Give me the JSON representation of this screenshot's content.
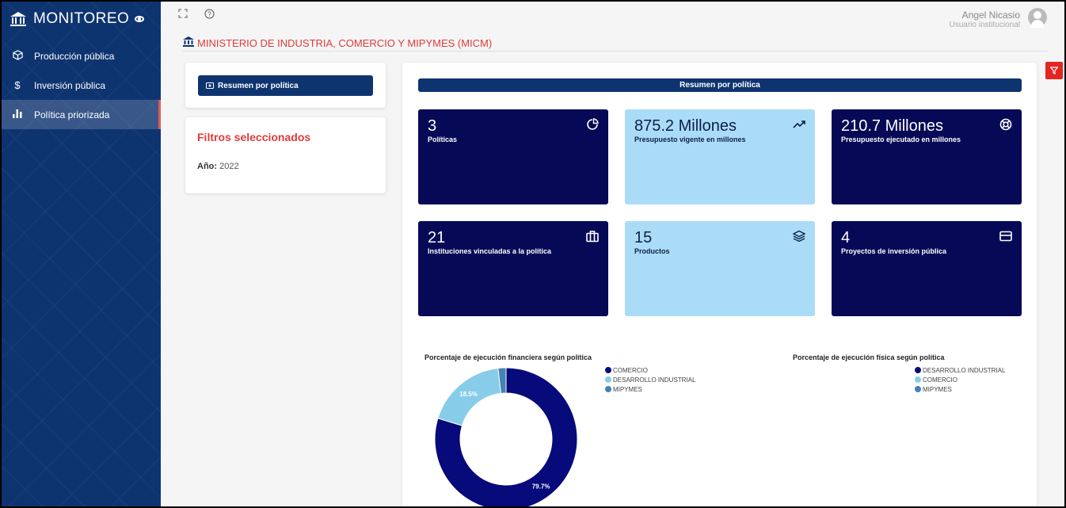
{
  "app": {
    "title": "MONITOREO"
  },
  "sidebar": {
    "items": [
      {
        "label": "Producción pública",
        "icon": "cube-icon"
      },
      {
        "label": "Inversión pública",
        "icon": "dollar-icon"
      },
      {
        "label": "Política priorizada",
        "icon": "bar-chart-icon"
      }
    ]
  },
  "user": {
    "name": "Angel Nicasio",
    "role": "Usuario institucional"
  },
  "ministry": {
    "name": "MINISTERIO DE INDUSTRIA, COMERCIO Y MIPYMES (MICM)"
  },
  "left": {
    "summary_button": "Resumen por política",
    "filters_title": "Filtros seleccionados",
    "year_label": "Año:",
    "year_value": "2022"
  },
  "main": {
    "header": "Resumen por política",
    "kpis": [
      {
        "value": "3",
        "label": "Políticas",
        "icon": "pie-icon",
        "theme": "dark"
      },
      {
        "value": "875.2 Millones",
        "label": "Presupuesto vigente en millones",
        "icon": "trending-up-icon",
        "theme": "light"
      },
      {
        "value": "210.7 Millones",
        "label": "Presupuesto ejecutado en millones",
        "icon": "lifebuoy-icon",
        "theme": "dark"
      },
      {
        "value": "21",
        "label": "Instituciones vinculadas a la política",
        "icon": "briefcase-icon",
        "theme": "dark"
      },
      {
        "value": "15",
        "label": "Productos",
        "icon": "layers-icon",
        "theme": "light"
      },
      {
        "value": "4",
        "label": "Proyectos de inversión pública",
        "icon": "credit-card-icon",
        "theme": "dark"
      }
    ]
  },
  "colors": {
    "navy": "#060a56",
    "light_blue": "#87cdea",
    "steel_blue": "#4682b4",
    "red": "#e03a3a"
  },
  "chart_data": [
    {
      "type": "pie",
      "title": "Porcentaje de ejecución financiera según política",
      "categories": [
        "COMERCIO",
        "DESARROLLO INDUSTRIAL",
        "MIPYMES"
      ],
      "values": [
        79.7,
        18.5,
        1.8
      ],
      "data_labels": [
        "79.7%",
        "18.5%",
        ""
      ],
      "colors": [
        "#060a7a",
        "#87cdea",
        "#4682b4"
      ],
      "donut": true,
      "legend": "right"
    },
    {
      "type": "pie",
      "title": "Porcentaje de ejecución física según política",
      "categories": [
        "DESARROLLO INDUSTRIAL",
        "COMERCIO",
        "MIPYMES"
      ],
      "colors": [
        "#060a7a",
        "#87cdea",
        "#4682b4"
      ],
      "legend": "right"
    }
  ]
}
